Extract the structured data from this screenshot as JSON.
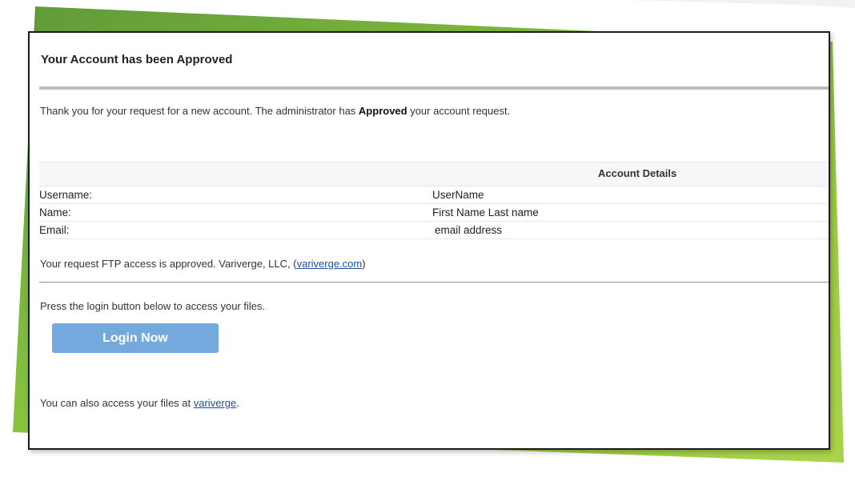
{
  "title": "Your Account has been Approved",
  "intro": {
    "before": "Thank you for your request for a new account. The administrator has ",
    "bold": "Approved",
    "after": " your account request."
  },
  "details": {
    "header": "Account Details",
    "rows": [
      {
        "label": "Username:",
        "value": "UserName"
      },
      {
        "label": "Name:",
        "value": "First Name Last name"
      },
      {
        "label": "Email:",
        "value": "email address"
      }
    ]
  },
  "ftp": {
    "text": "Your request FTP access is approved. Variverge, LLC, (",
    "link": "variverge.com",
    "after": ")"
  },
  "press_text": "Press the login button below to access your files.",
  "login_button": "Login Now",
  "also": {
    "text": "You can also access your files at ",
    "link": "variverge",
    "after": "."
  },
  "colors": {
    "accent_green": "#8cc63f",
    "button_blue": "#74a9dd",
    "link_blue": "#1f4fa3"
  }
}
